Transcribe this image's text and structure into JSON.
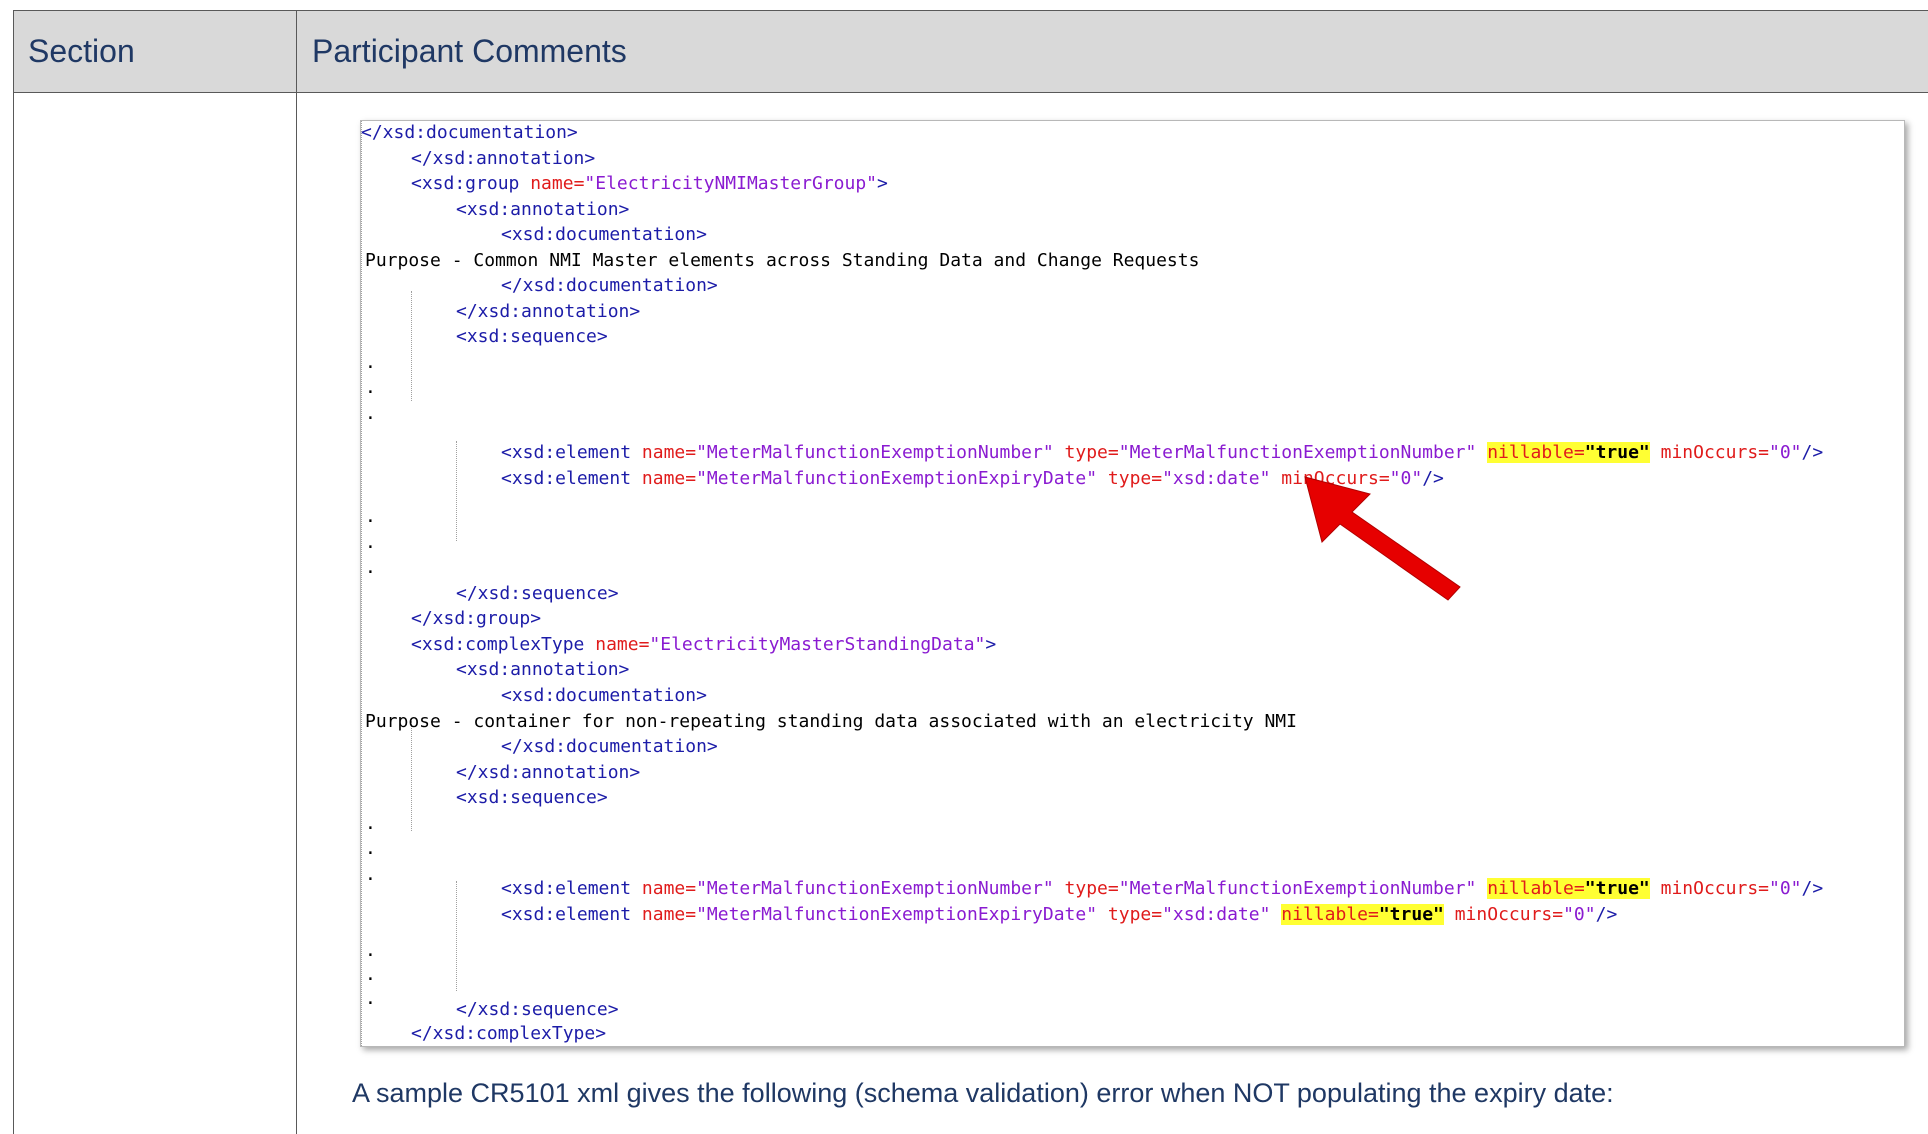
{
  "table": {
    "header": {
      "section": "Section",
      "comments": "Participant Comments"
    }
  },
  "code": {
    "l1": "</xsd:documentation>",
    "l2": "</xsd:annotation>",
    "l3_tag": "<xsd:group ",
    "l3_attr": "name=",
    "l3_val": "\"ElectricityNMIMasterGroup\"",
    "l3_end": ">",
    "l4": "<xsd:annotation>",
    "l5": "<xsd:documentation>",
    "l6": "Purpose - Common NMI Master elements across Standing Data and Change Requests",
    "l7": "</xsd:documentation>",
    "l8": "</xsd:annotation>",
    "l9": "<xsd:sequence>",
    "dot": ".",
    "el_tag": "<xsd:element ",
    "name_attr": "name=",
    "type_attr": "type=",
    "nillable_attr": "nillable=",
    "minoccurs_attr": "minOccurs=",
    "num_name": "\"MeterMalfunctionExemptionNumber\"",
    "num_type": "\"MeterMalfunctionExemptionNumber\"",
    "true_val": "\"true\"",
    "zero_val": "\"0\"",
    "self_close": "/>",
    "exp_name": "\"MeterMalfunctionExemptionExpiryDate\"",
    "exp_type": "\"xsd:date\"",
    "seq_close": "</xsd:sequence>",
    "group_close": "</xsd:group>",
    "ct_tag": "<xsd:complexType ",
    "ct_val": "\"ElectricityMasterStandingData\"",
    "ct_end": ">",
    "l23": "Purpose - container for non-repeating standing data associated with an electricity NMI",
    "ct_close": "</xsd:complexType>"
  },
  "caption": "A sample CR5101 xml gives the following (schema validation) error when NOT populating the expiry date:",
  "colors": {
    "header_bg": "#d9d9d9",
    "text_blue": "#1f3864",
    "highlight": "#ffff33",
    "arrow": "#e60000"
  }
}
